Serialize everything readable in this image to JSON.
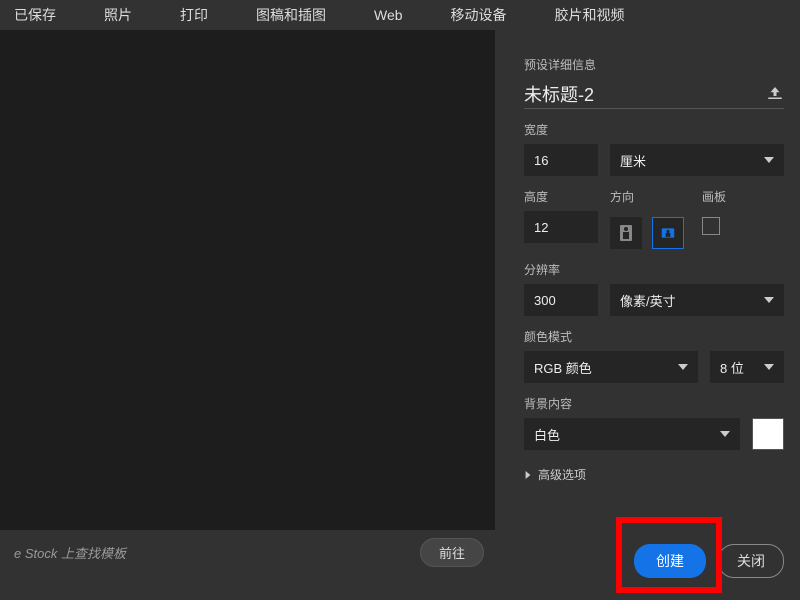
{
  "tabs": [
    "已保存",
    "照片",
    "打印",
    "图稿和插图",
    "Web",
    "移动设备",
    "胶片和视频"
  ],
  "panel": {
    "preset_details": "预设详细信息",
    "title": "未标题-2",
    "width": {
      "label": "宽度",
      "value": "16",
      "unit": "厘米"
    },
    "height": {
      "label": "高度",
      "value": "12"
    },
    "orientation_label": "方向",
    "artboard_label": "画板",
    "resolution": {
      "label": "分辨率",
      "value": "300",
      "unit": "像素/英寸"
    },
    "color_mode": {
      "label": "颜色模式",
      "value": "RGB 颜色",
      "depth": "8 位"
    },
    "bg": {
      "label": "背景内容",
      "value": "白色"
    },
    "advanced": "高级选项"
  },
  "stock": {
    "placeholder": "e Stock  上查找模板",
    "go": "前往"
  },
  "footer": {
    "create": "创建",
    "close": "关闭"
  }
}
